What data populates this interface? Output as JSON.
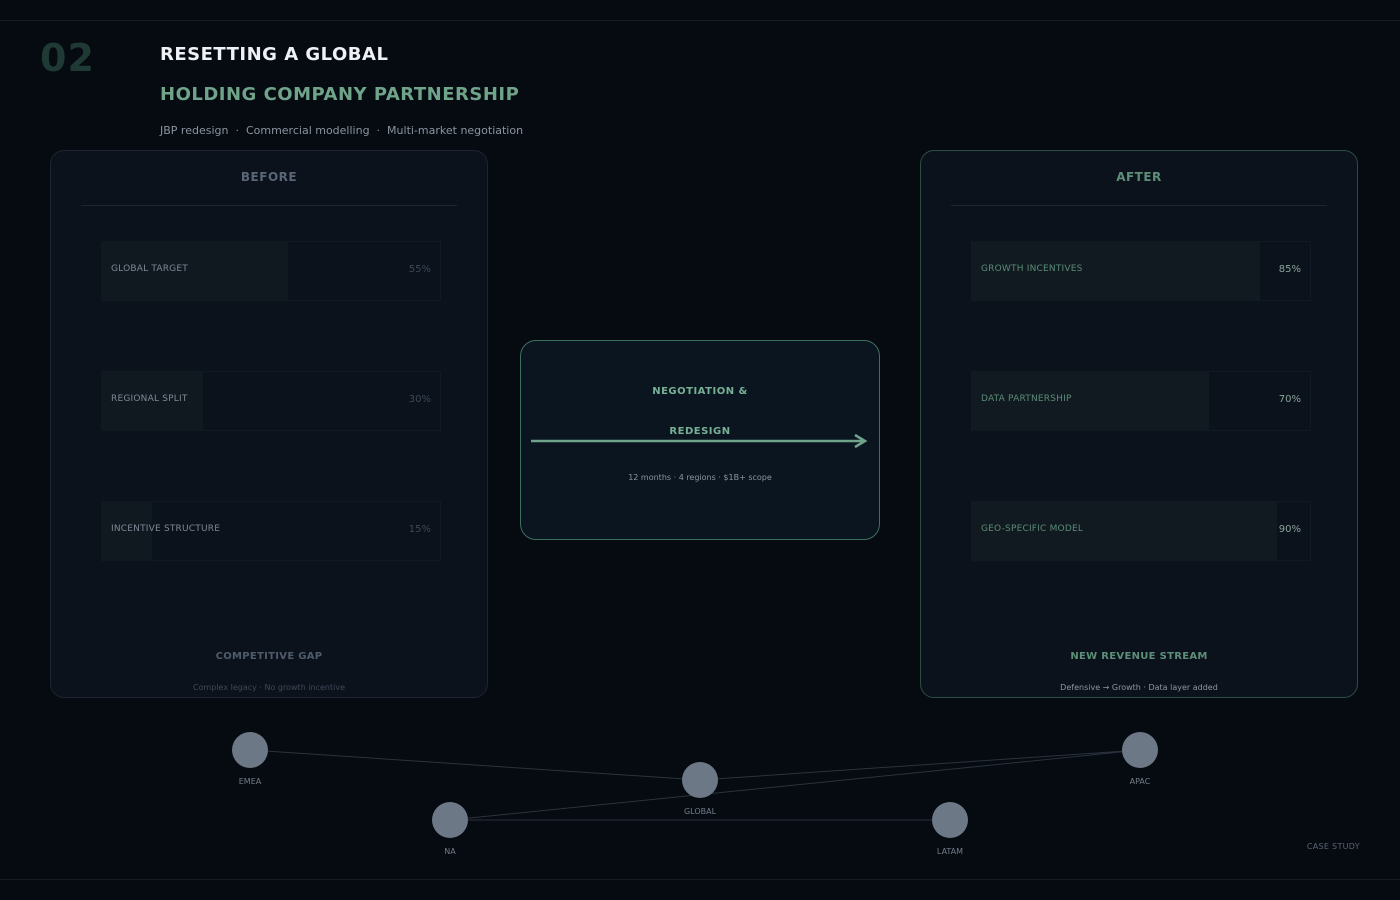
{
  "header": {
    "section_number": "02",
    "title_line1": "RESETTING A GLOBAL",
    "title_line2": "HOLDING COMPANY PARTNERSHIP",
    "tags": [
      "JBP redesign",
      "Commercial modelling",
      "Multi-market negotiation"
    ]
  },
  "before": {
    "title": "BEFORE",
    "bars": [
      {
        "label": "GLOBAL TARGET",
        "value": 55,
        "display": "55%"
      },
      {
        "label": "REGIONAL SPLIT",
        "value": 30,
        "display": "30%"
      },
      {
        "label": "INCENTIVE STRUCTURE",
        "value": 15,
        "display": "15%"
      }
    ],
    "footer_title": "COMPETITIVE GAP",
    "footer_sub": "Complex legacy · No growth incentive"
  },
  "after": {
    "title": "AFTER",
    "bars": [
      {
        "label": "GROWTH INCENTIVES",
        "value": 85,
        "display": "85%"
      },
      {
        "label": "DATA PARTNERSHIP",
        "value": 70,
        "display": "70%"
      },
      {
        "label": "GEO-SPECIFIC MODEL",
        "value": 90,
        "display": "90%"
      }
    ],
    "footer_title": "NEW REVENUE STREAM",
    "footer_sub": "Defensive → Growth · Data layer added"
  },
  "center": {
    "line1": "NEGOTIATION &",
    "line2": "REDESIGN",
    "meta": "12 months · 4 regions · $1B+ scope"
  },
  "network": {
    "nodes": [
      {
        "id": "emea",
        "label": "EMEA"
      },
      {
        "id": "global",
        "label": "GLOBAL"
      },
      {
        "id": "apac",
        "label": "APAC"
      },
      {
        "id": "na",
        "label": "NA"
      },
      {
        "id": "latam",
        "label": "LATAM"
      }
    ],
    "edges": [
      [
        "emea",
        "global"
      ],
      [
        "global",
        "apac"
      ],
      [
        "na",
        "apac"
      ],
      [
        "na",
        "latam"
      ]
    ]
  },
  "footer": {
    "case_study": "CASE STUDY"
  },
  "colors": {
    "accent": "#6fa38a",
    "background": "#060a11",
    "panel": "#0b121c",
    "node": "#6c7885"
  }
}
